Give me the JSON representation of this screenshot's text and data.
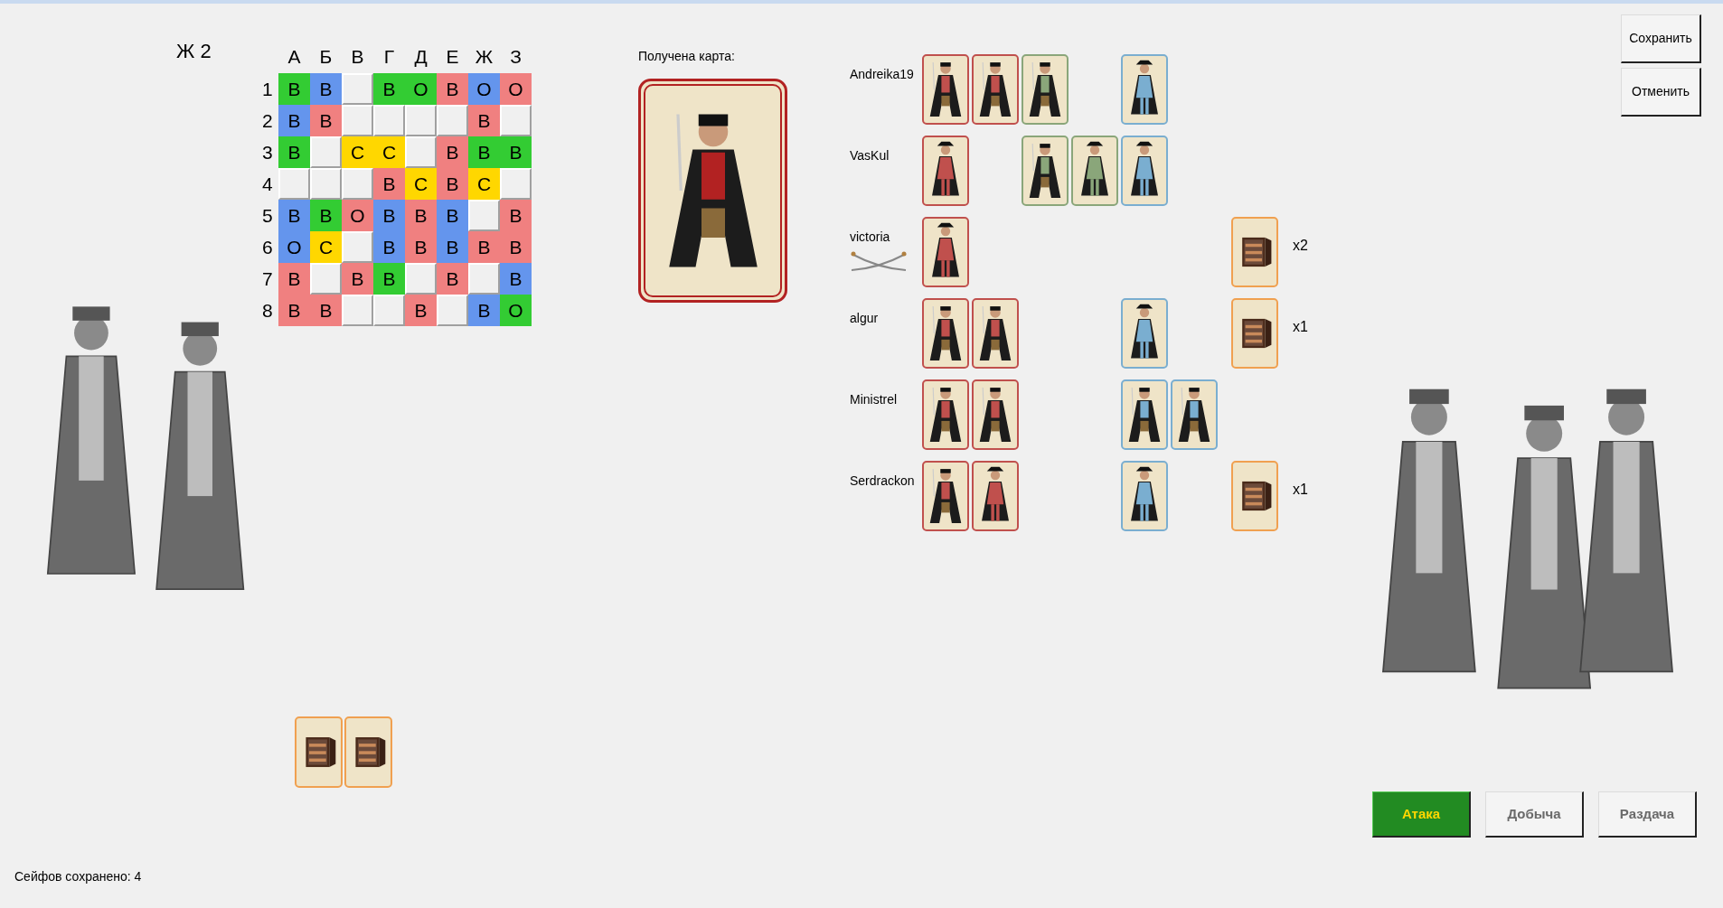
{
  "player_label": "Ж 2",
  "board": {
    "columns": [
      "А",
      "Б",
      "В",
      "Г",
      "Д",
      "Е",
      "Ж",
      "З"
    ],
    "rows": [
      {
        "label": "1",
        "cells": [
          {
            "kind": "filled",
            "text": "В",
            "color": "#33cc33"
          },
          {
            "kind": "filled",
            "text": "В",
            "color": "#6495ed"
          },
          {
            "kind": "empty"
          },
          {
            "kind": "filled",
            "text": "В",
            "color": "#33cc33"
          },
          {
            "kind": "filled",
            "text": "О",
            "color": "#33cc33"
          },
          {
            "kind": "filled",
            "text": "В",
            "color": "#f08080"
          },
          {
            "kind": "filled",
            "text": "О",
            "color": "#6495ed"
          },
          {
            "kind": "filled",
            "text": "О",
            "color": "#f08080"
          }
        ]
      },
      {
        "label": "2",
        "cells": [
          {
            "kind": "filled",
            "text": "В",
            "color": "#6495ed"
          },
          {
            "kind": "filled",
            "text": "В",
            "color": "#f08080"
          },
          {
            "kind": "empty"
          },
          {
            "kind": "empty"
          },
          {
            "kind": "empty"
          },
          {
            "kind": "empty"
          },
          {
            "kind": "filled",
            "text": "В",
            "color": "#f08080"
          },
          {
            "kind": "empty"
          }
        ]
      },
      {
        "label": "3",
        "cells": [
          {
            "kind": "filled",
            "text": "В",
            "color": "#33cc33"
          },
          {
            "kind": "empty"
          },
          {
            "kind": "filled",
            "text": "С",
            "color": "#ffd700"
          },
          {
            "kind": "filled",
            "text": "С",
            "color": "#ffd700"
          },
          {
            "kind": "empty"
          },
          {
            "kind": "filled",
            "text": "В",
            "color": "#f08080"
          },
          {
            "kind": "filled",
            "text": "В",
            "color": "#33cc33"
          },
          {
            "kind": "filled",
            "text": "В",
            "color": "#33cc33"
          }
        ]
      },
      {
        "label": "4",
        "cells": [
          {
            "kind": "empty"
          },
          {
            "kind": "empty"
          },
          {
            "kind": "empty"
          },
          {
            "kind": "filled",
            "text": "В",
            "color": "#f08080"
          },
          {
            "kind": "filled",
            "text": "С",
            "color": "#ffd700"
          },
          {
            "kind": "filled",
            "text": "В",
            "color": "#f08080"
          },
          {
            "kind": "filled",
            "text": "С",
            "color": "#ffd700"
          },
          {
            "kind": "empty"
          }
        ]
      },
      {
        "label": "5",
        "cells": [
          {
            "kind": "filled",
            "text": "В",
            "color": "#6495ed"
          },
          {
            "kind": "filled",
            "text": "В",
            "color": "#33cc33"
          },
          {
            "kind": "filled",
            "text": "О",
            "color": "#f08080"
          },
          {
            "kind": "filled",
            "text": "В",
            "color": "#6495ed"
          },
          {
            "kind": "filled",
            "text": "В",
            "color": "#f08080"
          },
          {
            "kind": "filled",
            "text": "В",
            "color": "#6495ed"
          },
          {
            "kind": "empty"
          },
          {
            "kind": "filled",
            "text": "В",
            "color": "#f08080"
          }
        ]
      },
      {
        "label": "6",
        "cells": [
          {
            "kind": "filled",
            "text": "О",
            "color": "#6495ed"
          },
          {
            "kind": "filled",
            "text": "С",
            "color": "#ffd700"
          },
          {
            "kind": "empty"
          },
          {
            "kind": "filled",
            "text": "В",
            "color": "#6495ed"
          },
          {
            "kind": "filled",
            "text": "В",
            "color": "#f08080"
          },
          {
            "kind": "filled",
            "text": "В",
            "color": "#6495ed"
          },
          {
            "kind": "filled",
            "text": "В",
            "color": "#f08080"
          },
          {
            "kind": "filled",
            "text": "В",
            "color": "#f08080"
          }
        ]
      },
      {
        "label": "7",
        "cells": [
          {
            "kind": "filled",
            "text": "В",
            "color": "#f08080"
          },
          {
            "kind": "empty"
          },
          {
            "kind": "filled",
            "text": "В",
            "color": "#f08080"
          },
          {
            "kind": "filled",
            "text": "В",
            "color": "#33cc33"
          },
          {
            "kind": "empty"
          },
          {
            "kind": "filled",
            "text": "В",
            "color": "#f08080"
          },
          {
            "kind": "empty"
          },
          {
            "kind": "filled",
            "text": "В",
            "color": "#6495ed"
          }
        ]
      },
      {
        "label": "8",
        "cells": [
          {
            "kind": "filled",
            "text": "В",
            "color": "#f08080"
          },
          {
            "kind": "filled",
            "text": "В",
            "color": "#f08080"
          },
          {
            "kind": "empty"
          },
          {
            "kind": "empty"
          },
          {
            "kind": "filled",
            "text": "В",
            "color": "#f08080"
          },
          {
            "kind": "empty"
          },
          {
            "kind": "filled",
            "text": "В",
            "color": "#6495ed"
          },
          {
            "kind": "filled",
            "text": "О",
            "color": "#33cc33"
          }
        ]
      }
    ]
  },
  "received_card": {
    "label": "Получена карта:",
    "kind": "man",
    "color": "#b22222"
  },
  "players": [
    {
      "name": "Andreika19",
      "crossed_sabres": false,
      "red_group": [
        {
          "kind": "man",
          "color": "#c0504d"
        },
        {
          "kind": "man",
          "color": "#c0504d"
        }
      ],
      "green_group": [
        {
          "kind": "man",
          "color": "#8aa67a"
        }
      ],
      "blue_group": [
        {
          "kind": "woman",
          "color": "#7aaed0"
        }
      ]
    },
    {
      "name": "VasKul",
      "crossed_sabres": false,
      "red_group": [
        {
          "kind": "woman",
          "color": "#c0504d"
        }
      ],
      "green_group": [
        {
          "kind": "man",
          "color": "#8aa67a"
        },
        {
          "kind": "woman",
          "color": "#8aa67a"
        }
      ],
      "blue_group": [
        {
          "kind": "woman",
          "color": "#7aaed0"
        }
      ]
    },
    {
      "name": "victoria",
      "crossed_sabres": true,
      "red_group": [
        {
          "kind": "woman",
          "color": "#c0504d"
        }
      ],
      "safe": {
        "count": "x2"
      }
    },
    {
      "name": "algur",
      "crossed_sabres": false,
      "red_group": [
        {
          "kind": "man",
          "color": "#c0504d"
        },
        {
          "kind": "man",
          "color": "#c0504d"
        }
      ],
      "blue_group": [
        {
          "kind": "woman",
          "color": "#7aaed0"
        }
      ],
      "safe": {
        "count": "x1"
      }
    },
    {
      "name": "Ministrel",
      "crossed_sabres": false,
      "red_group": [
        {
          "kind": "man",
          "color": "#c0504d"
        },
        {
          "kind": "man",
          "color": "#c0504d"
        }
      ],
      "blue_group": [
        {
          "kind": "man",
          "color": "#7aaed0"
        },
        {
          "kind": "man",
          "color": "#7aaed0"
        }
      ]
    },
    {
      "name": "Serdrackon",
      "crossed_sabres": false,
      "red_group": [
        {
          "kind": "man",
          "color": "#c0504d"
        },
        {
          "kind": "woman",
          "color": "#c0504d"
        }
      ],
      "blue_group": [
        {
          "kind": "woman",
          "color": "#7aaed0"
        }
      ],
      "safe": {
        "count": "x1"
      }
    }
  ],
  "hand": [
    {
      "kind": "safe"
    },
    {
      "kind": "safe"
    }
  ],
  "top_buttons": [
    "Сохранить",
    "Отменить"
  ],
  "action_buttons": [
    {
      "label": "Атака",
      "kind": "primary"
    },
    {
      "label": "Добыча",
      "kind": "normal"
    },
    {
      "label": "Раздача",
      "kind": "normal"
    }
  ],
  "status": "Сейфов сохранено: 4"
}
